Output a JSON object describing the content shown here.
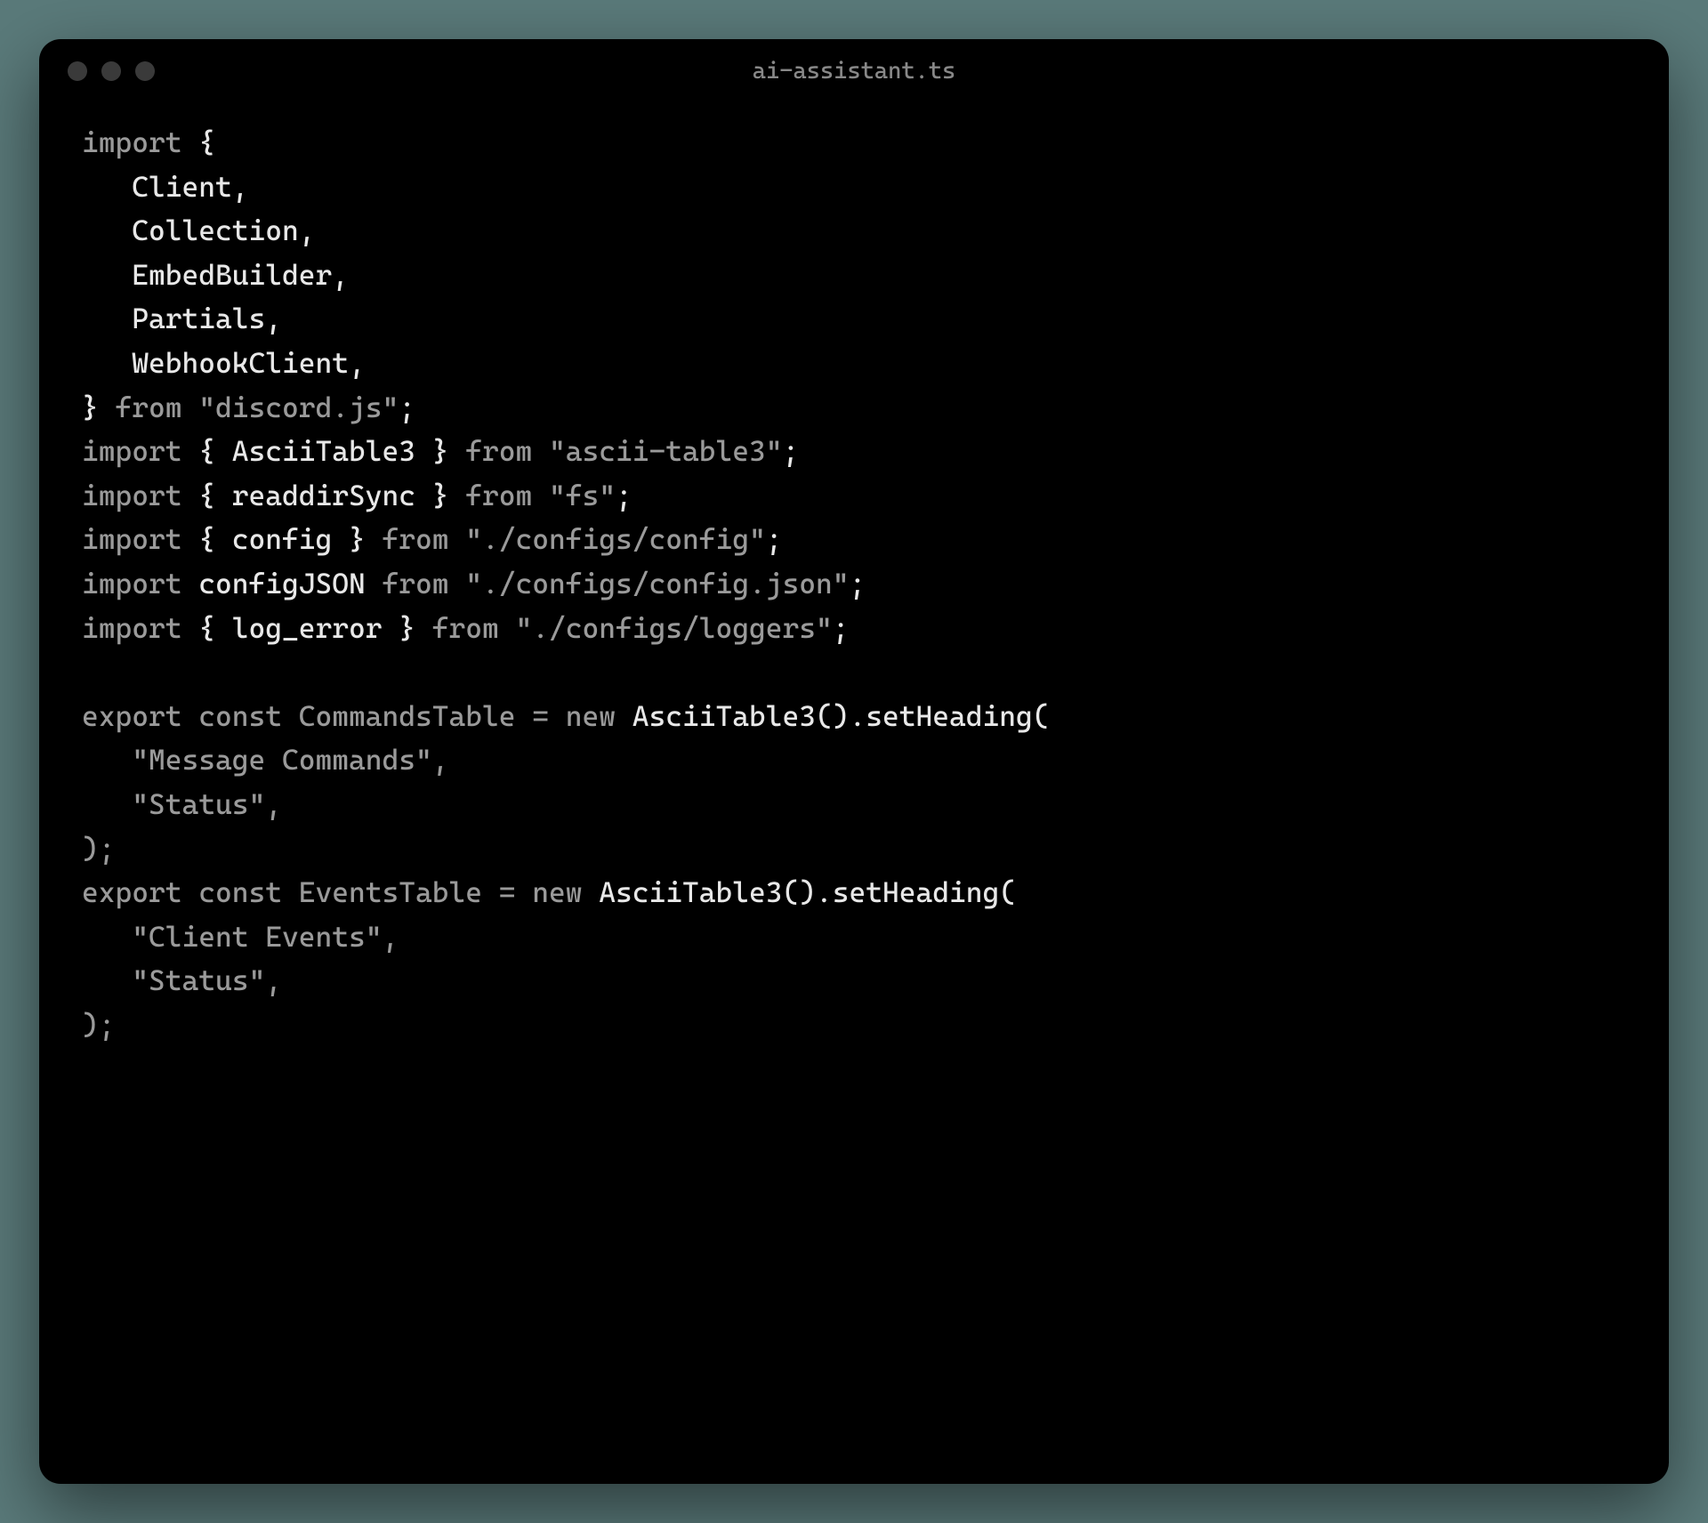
{
  "window": {
    "title": "ai-assistant.ts"
  },
  "code": {
    "tokens": [
      [
        [
          "import ",
          "keyword"
        ],
        [
          "{",
          "punct"
        ]
      ],
      [
        [
          "   ",
          "plain"
        ],
        [
          "Client",
          "ident"
        ],
        [
          ",",
          "punct"
        ]
      ],
      [
        [
          "   ",
          "plain"
        ],
        [
          "Collection",
          "ident"
        ],
        [
          ",",
          "punct"
        ]
      ],
      [
        [
          "   ",
          "plain"
        ],
        [
          "EmbedBuilder",
          "ident"
        ],
        [
          ",",
          "punct"
        ]
      ],
      [
        [
          "   ",
          "plain"
        ],
        [
          "Partials",
          "ident"
        ],
        [
          ",",
          "punct"
        ]
      ],
      [
        [
          "   ",
          "plain"
        ],
        [
          "WebhookClient",
          "ident"
        ],
        [
          ",",
          "punct"
        ]
      ],
      [
        [
          "} ",
          "punct"
        ],
        [
          "from ",
          "keyword"
        ],
        [
          "\"discord.js\"",
          "string"
        ],
        [
          ";",
          "punct"
        ]
      ],
      [
        [
          "import ",
          "keyword"
        ],
        [
          "{ AsciiTable3 } ",
          "punct"
        ],
        [
          "from ",
          "keyword"
        ],
        [
          "\"ascii-table3\"",
          "string"
        ],
        [
          ";",
          "punct"
        ]
      ],
      [
        [
          "import ",
          "keyword"
        ],
        [
          "{ readdirSync } ",
          "punct"
        ],
        [
          "from ",
          "keyword"
        ],
        [
          "\"fs\"",
          "string"
        ],
        [
          ";",
          "punct"
        ]
      ],
      [
        [
          "import ",
          "keyword"
        ],
        [
          "{ config } ",
          "punct"
        ],
        [
          "from ",
          "keyword"
        ],
        [
          "\"./configs/config\"",
          "string"
        ],
        [
          ";",
          "punct"
        ]
      ],
      [
        [
          "import ",
          "keyword"
        ],
        [
          "configJSON ",
          "ident"
        ],
        [
          "from ",
          "keyword"
        ],
        [
          "\"./configs/config.json\"",
          "string"
        ],
        [
          ";",
          "punct"
        ]
      ],
      [
        [
          "import ",
          "keyword"
        ],
        [
          "{ log_error } ",
          "punct"
        ],
        [
          "from ",
          "keyword"
        ],
        [
          "\"./configs/loggers\"",
          "string"
        ],
        [
          ";",
          "punct"
        ]
      ],
      [
        [
          "",
          "plain"
        ]
      ],
      [
        [
          "export ",
          "keyword"
        ],
        [
          "const ",
          "keyword"
        ],
        [
          "CommandsTable ",
          "dim"
        ],
        [
          "= ",
          "dim"
        ],
        [
          "new ",
          "keyword"
        ],
        [
          "AsciiTable3().setHeading(",
          "ident"
        ]
      ],
      [
        [
          "   ",
          "plain"
        ],
        [
          "\"Message Commands\"",
          "string"
        ],
        [
          ",",
          "dim"
        ]
      ],
      [
        [
          "   ",
          "plain"
        ],
        [
          "\"Status\"",
          "string"
        ],
        [
          ",",
          "dim"
        ]
      ],
      [
        [
          ");",
          "dim"
        ]
      ],
      [
        [
          "export ",
          "keyword"
        ],
        [
          "const ",
          "keyword"
        ],
        [
          "EventsTable ",
          "dim"
        ],
        [
          "= ",
          "dim"
        ],
        [
          "new ",
          "keyword"
        ],
        [
          "AsciiTable3().setHeading(",
          "ident"
        ]
      ],
      [
        [
          "   ",
          "plain"
        ],
        [
          "\"Client Events\"",
          "string"
        ],
        [
          ",",
          "dim"
        ]
      ],
      [
        [
          "   ",
          "plain"
        ],
        [
          "\"Status\"",
          "string"
        ],
        [
          ",",
          "dim"
        ]
      ],
      [
        [
          ");",
          "dim"
        ]
      ]
    ]
  }
}
